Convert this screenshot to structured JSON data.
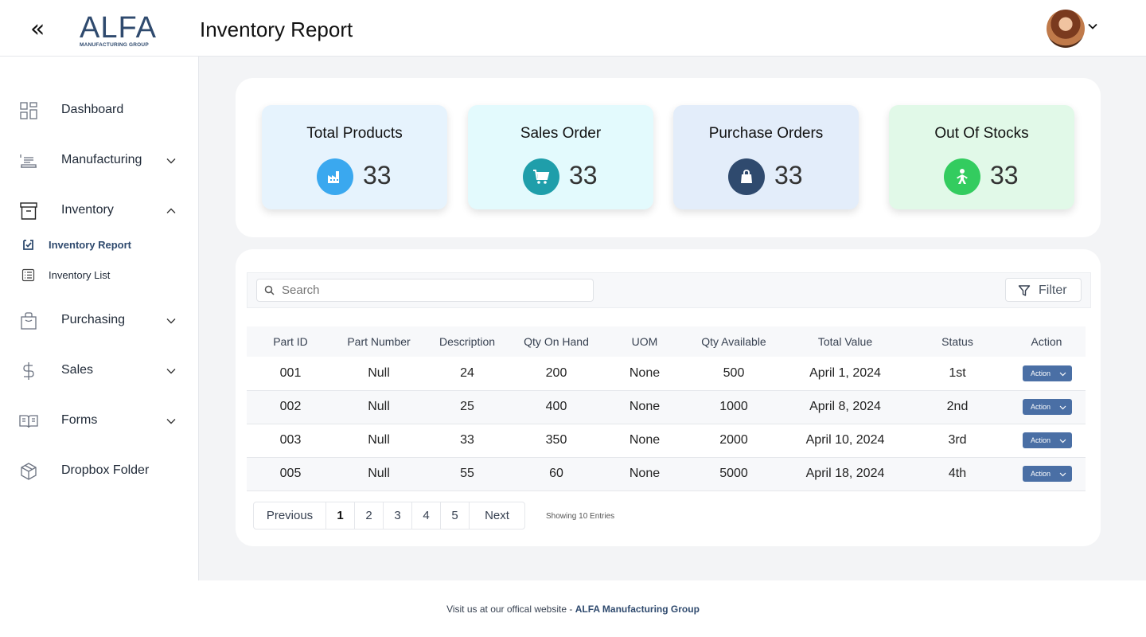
{
  "header": {
    "collapse_glyph": "«",
    "logo_main": "ALFA",
    "logo_sub": "MANUFACTURING GROUP",
    "title": "Inventory Report"
  },
  "sidebar": {
    "items": [
      {
        "label": "Dashboard",
        "icon": "grid-icon"
      },
      {
        "label": "Manufacturing",
        "icon": "factory-icon"
      },
      {
        "label": "Inventory",
        "icon": "archive-box-icon"
      },
      {
        "label": "Purchasing",
        "icon": "shopping-bag-icon"
      },
      {
        "label": "Sales",
        "icon": "dollar-icon"
      },
      {
        "label": "Forms",
        "icon": "book-icon"
      },
      {
        "label": "Dropbox Folder",
        "icon": "cube-icon"
      }
    ],
    "inventory_sub": [
      {
        "label": "Inventory Report",
        "active": true
      },
      {
        "label": "Inventory List",
        "active": false
      }
    ]
  },
  "stats": [
    {
      "title": "Total Products",
      "value": "33",
      "icon": "factory-icon",
      "bg": "#e6f3fd",
      "icon_bg": "#3aa8ef"
    },
    {
      "title": "Sales Order",
      "value": "33",
      "icon": "cart-icon",
      "bg": "#e3fafd",
      "icon_bg": "#1f9eaa"
    },
    {
      "title": "Purchase Orders",
      "value": "33",
      "icon": "bag-icon",
      "bg": "#e3edfa",
      "icon_bg": "#2f4a6e"
    },
    {
      "title": "Out Of Stocks",
      "value": "33",
      "icon": "person-icon",
      "bg": "#e1f9e8",
      "icon_bg": "#33cc5f"
    }
  ],
  "toolbar": {
    "search_placeholder": "Search",
    "filter_label": "Filter"
  },
  "table": {
    "columns": [
      "Part ID",
      "Part Number",
      "Description",
      "Qty On Hand",
      "UOM",
      "Qty Available",
      "Total Value",
      "Status",
      "Action"
    ],
    "rows": [
      {
        "part_id": "001",
        "part_number": "Null",
        "description": "24",
        "qty_on_hand": "200",
        "uom": "None",
        "qty_available": "500",
        "total_value": "April 1, 2024",
        "status": "1st",
        "action": "Action"
      },
      {
        "part_id": "002",
        "part_number": "Null",
        "description": "25",
        "qty_on_hand": "400",
        "uom": "None",
        "qty_available": "1000",
        "total_value": "April 8, 2024",
        "status": "2nd",
        "action": "Action"
      },
      {
        "part_id": "003",
        "part_number": "Null",
        "description": "33",
        "qty_on_hand": "350",
        "uom": "None",
        "qty_available": "2000",
        "total_value": "April 10, 2024",
        "status": "3rd",
        "action": "Action"
      },
      {
        "part_id": "005",
        "part_number": "Null",
        "description": "55",
        "qty_on_hand": "60",
        "uom": "None",
        "qty_available": "5000",
        "total_value": "April 18, 2024",
        "status": "4th",
        "action": "Action"
      }
    ]
  },
  "pagination": {
    "previous": "Previous",
    "pages": [
      "1",
      "2",
      "3",
      "4",
      "5"
    ],
    "current": "1",
    "next": "Next",
    "entries_text": "Showing 10 Entries"
  },
  "footer": {
    "text": "Visit us at our offical website - ",
    "link": "ALFA Manufacturing Group"
  }
}
